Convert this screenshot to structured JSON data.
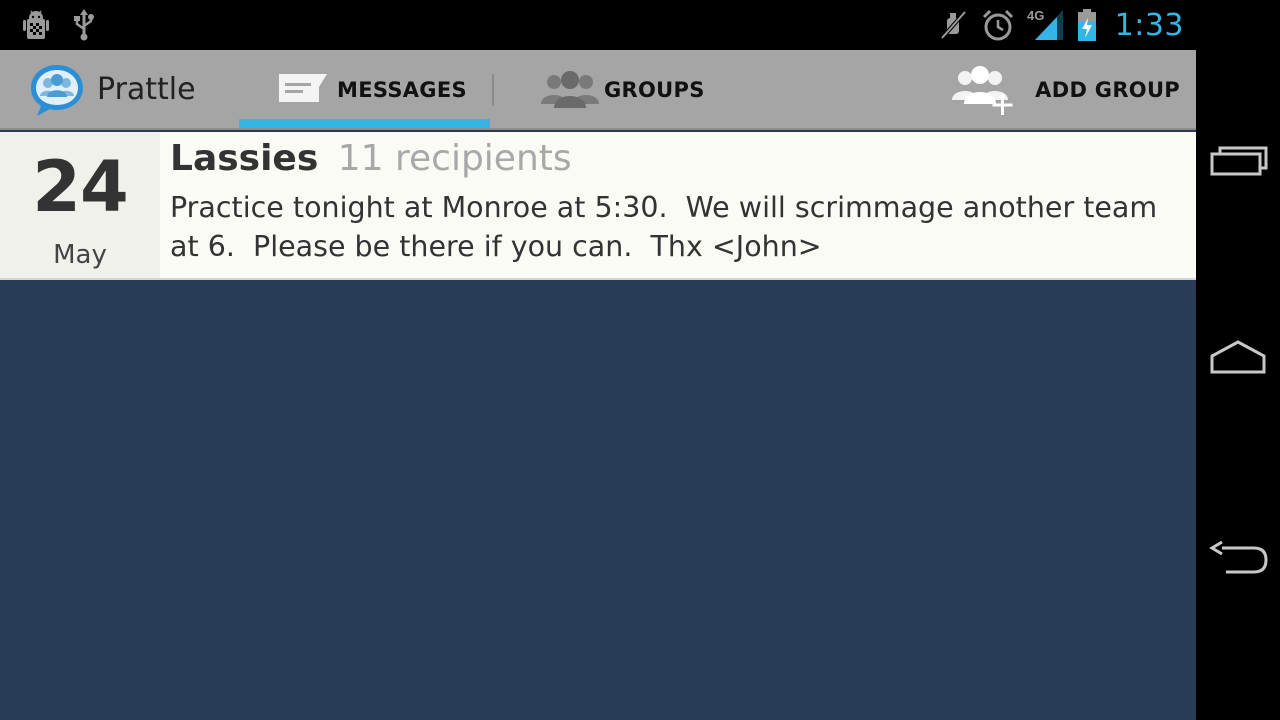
{
  "status_bar": {
    "left_icons": [
      "android-debug-icon",
      "usb-icon"
    ],
    "right_icons": [
      "muted-icon",
      "alarm-icon",
      "signal-4g-icon",
      "battery-charging-icon"
    ],
    "network_label": "4G",
    "time": "1:33",
    "accent_color": "#33b5e5"
  },
  "action_bar": {
    "app_title": "Prattle",
    "tabs": [
      {
        "label": "MESSAGES",
        "icon": "message-icon",
        "selected": true
      },
      {
        "label": "GROUPS",
        "icon": "groups-icon",
        "selected": false
      }
    ],
    "add_group_label": "ADD GROUP",
    "add_group_icon": "add-group-icon",
    "background_color": "#a5a5a5"
  },
  "messages": [
    {
      "day": "24",
      "month": "May",
      "group": "Lassies",
      "recipients": "11 recipients",
      "body": "Practice tonight at Monroe at 5:30.  We will scrimmage another team at 6.  Please be there if you can.  Thx <John>"
    }
  ],
  "content_background_color": "#283c58",
  "nav_bar": {
    "buttons": [
      "recent-apps-icon",
      "home-icon",
      "back-icon"
    ]
  }
}
